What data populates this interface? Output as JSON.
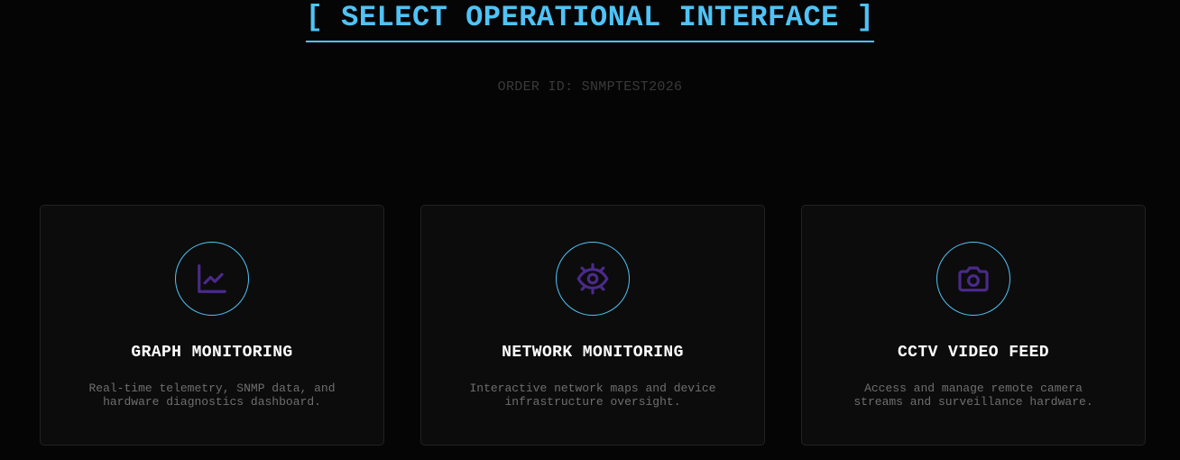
{
  "header": {
    "title": "[ SELECT OPERATIONAL INTERFACE ]",
    "order_id": "ORDER ID: SNMPTEST2026"
  },
  "colors": {
    "accent": "#4fc3f7",
    "icon": "#4a2a8a",
    "background": "#050505",
    "card_background": "#0c0c0c"
  },
  "cards": [
    {
      "icon": "line-chart-icon",
      "title": "GRAPH MONITORING",
      "description": "Real-time telemetry, SNMP data, and hardware diagnostics dashboard."
    },
    {
      "icon": "eye-scan-icon",
      "title": "NETWORK MONITORING",
      "description": "Interactive network maps and device infrastructure oversight."
    },
    {
      "icon": "camera-icon",
      "title": "CCTV VIDEO FEED",
      "description": "Access and manage remote camera streams and surveillance hardware."
    }
  ]
}
